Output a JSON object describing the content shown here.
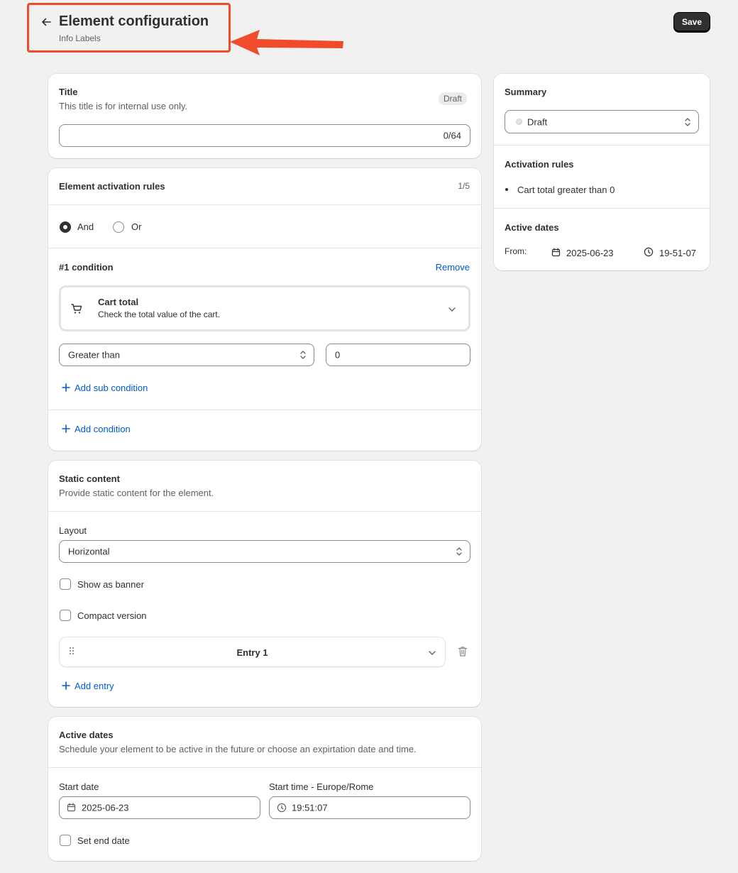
{
  "header": {
    "title": "Element configuration",
    "subtitle": "Info Labels",
    "save_label": "Save"
  },
  "title_card": {
    "heading": "Title",
    "description": "This title is for internal use only.",
    "badge": "Draft",
    "input_value": "",
    "counter": "0/64"
  },
  "activation_card": {
    "heading": "Element activation rules",
    "count": "1/5",
    "logic_options": [
      {
        "label": "And",
        "selected": true
      },
      {
        "label": "Or",
        "selected": false
      }
    ],
    "condition_heading": "#1 condition",
    "remove_label": "Remove",
    "condition_type_title": "Cart total",
    "condition_type_desc": "Check the total value of the cart.",
    "operator": "Greater than",
    "value": "0",
    "add_sub_condition": "Add sub condition",
    "add_condition": "Add condition"
  },
  "static_card": {
    "heading": "Static content",
    "description": "Provide static content for the element.",
    "layout_label": "Layout",
    "layout_value": "Horizontal",
    "show_banner_label": "Show as banner",
    "compact_label": "Compact version",
    "entry_label": "Entry 1",
    "add_entry": "Add entry"
  },
  "dates_card": {
    "heading": "Active dates",
    "description": "Schedule your element to be active in the future or choose an expirtation date and time.",
    "start_date_label": "Start date",
    "start_date_value": "2025-06-23",
    "start_time_label": "Start time - Europe/Rome",
    "start_time_value": "19:51:07",
    "end_date_label": "Set end date"
  },
  "summary": {
    "heading": "Summary",
    "status": "Draft",
    "rules_heading": "Activation rules",
    "rules": [
      "Cart total greater than 0"
    ],
    "dates_heading": "Active dates",
    "from_label": "From:",
    "from_date": "2025-06-23",
    "from_time": "19-51-07"
  },
  "colors": {
    "accent_link": "#005bd3",
    "annotation": "#f04b2a",
    "primary_button": "#303030"
  }
}
